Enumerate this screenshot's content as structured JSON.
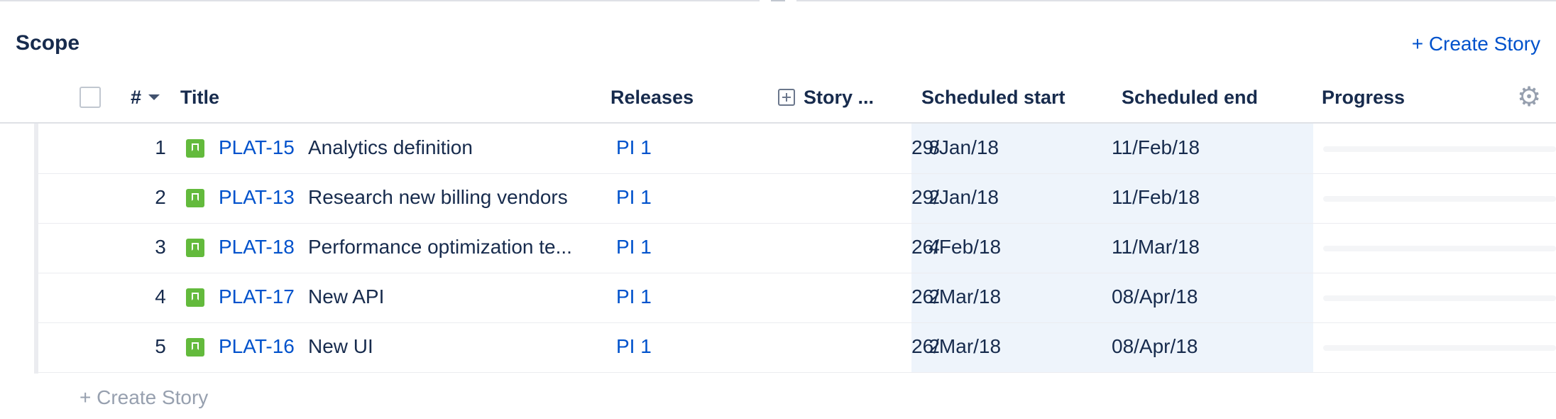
{
  "section": {
    "title": "Scope",
    "create_story_label": "+ Create Story",
    "create_story_bottom_label": "+ Create Story"
  },
  "columns": {
    "number": "#",
    "title": "Title",
    "releases": "Releases",
    "story_points": "Story ...",
    "scheduled_start": "Scheduled start",
    "scheduled_end": "Scheduled end",
    "progress": "Progress"
  },
  "icons": {
    "sort": "caret-down-icon",
    "expand": "expand-plus-icon",
    "settings": "gear-icon",
    "issue_type": "story-bookmark-icon"
  },
  "colors": {
    "link": "#0052cc",
    "story_icon": "#63ba3c",
    "schedule_highlight": "#eef4fb"
  },
  "rows": [
    {
      "num": "1",
      "key": "PLAT-15",
      "title": "Analytics definition",
      "release": "PI 1",
      "points": "8",
      "start": "29/Jan/18",
      "end": "11/Feb/18"
    },
    {
      "num": "2",
      "key": "PLAT-13",
      "title": "Research new billing vendors",
      "release": "PI 1",
      "points": "2",
      "start": "29/Jan/18",
      "end": "11/Feb/18"
    },
    {
      "num": "3",
      "key": "PLAT-18",
      "title": "Performance optimization te...",
      "release": "PI 1",
      "points": "4",
      "start": "26/Feb/18",
      "end": "11/Mar/18"
    },
    {
      "num": "4",
      "key": "PLAT-17",
      "title": "New API",
      "release": "PI 1",
      "points": "2",
      "start": "26/Mar/18",
      "end": "08/Apr/18"
    },
    {
      "num": "5",
      "key": "PLAT-16",
      "title": "New UI",
      "release": "PI 1",
      "points": "2",
      "start": "26/Mar/18",
      "end": "08/Apr/18"
    }
  ]
}
